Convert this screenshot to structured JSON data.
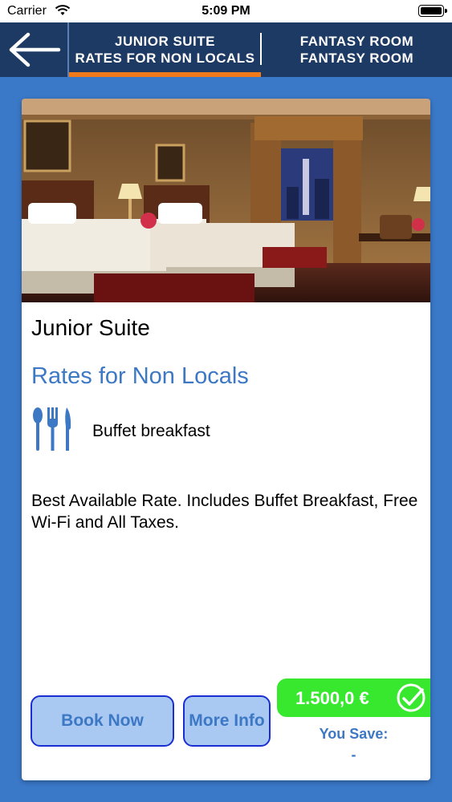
{
  "status_bar": {
    "carrier": "Carrier",
    "time": "5:09 PM",
    "wifi_icon": "wifi-icon",
    "battery_icon": "battery-icon"
  },
  "nav": {
    "back_icon": "back-arrow-icon",
    "tabs": [
      {
        "line1": "JUNIOR SUITE",
        "line2": "RATES FOR NON LOCALS",
        "active": true
      },
      {
        "line1": "FANTASY ROOM",
        "line2": "FANTASY ROOM",
        "active": false
      }
    ],
    "accent_color": "#f07a1a"
  },
  "card": {
    "photo_subject": "hotel room with two beds",
    "room_title": "Junior Suite",
    "rate_title": "Rates for Non Locals",
    "meal_icon": "cutlery-icon",
    "meal_label": "Buffet breakfast",
    "description": "Best Available Rate. Includes Buffet Breakfast, Free Wi-Fi and All Taxes.",
    "book_label": "Book Now",
    "info_label": "More Info",
    "price": "1.500,0 €",
    "price_icon": "check-circle-icon",
    "save_label": "You Save:",
    "save_value": "-"
  },
  "colors": {
    "background": "#3a78c8",
    "header": "#1c3a63",
    "link_blue": "#3d78c5",
    "price_green": "#37e82f",
    "button_fill": "#a9c8f2",
    "button_border": "#1a2fd1"
  }
}
